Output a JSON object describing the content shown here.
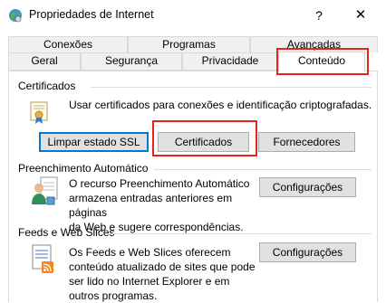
{
  "window": {
    "title": "Propriedades de Internet",
    "help_glyph": "?",
    "close_glyph": "✕"
  },
  "tabs": {
    "back_row": [
      "Conexões",
      "Programas",
      "Avançadas"
    ],
    "front_row": [
      "Geral",
      "Segurança",
      "Privacidade",
      "Conteúdo"
    ],
    "active": "Conteúdo"
  },
  "certificados": {
    "heading": "Certificados",
    "description": "Usar certificados para conexões e identificação criptografadas.",
    "buttons": {
      "clear_ssl": "Limpar estado SSL",
      "certificates": "Certificados",
      "publishers": "Fornecedores"
    }
  },
  "autocomplete": {
    "heading": "Preenchimento Automático",
    "description_lines": [
      "O recurso Preenchimento Automático",
      "armazena entradas anteriores em páginas",
      "da Web e sugere correspondências."
    ],
    "button": "Configurações"
  },
  "feeds": {
    "heading": "Feeds e Web Slices",
    "description_lines": [
      "Os Feeds e Web Slices oferecem",
      "conteúdo atualizado de sites que pode",
      "ser lido no Internet Explorer e em",
      "outros programas."
    ],
    "button": "Configurações"
  },
  "colors": {
    "highlight": "#e8231b",
    "focus": "#0078d7"
  }
}
